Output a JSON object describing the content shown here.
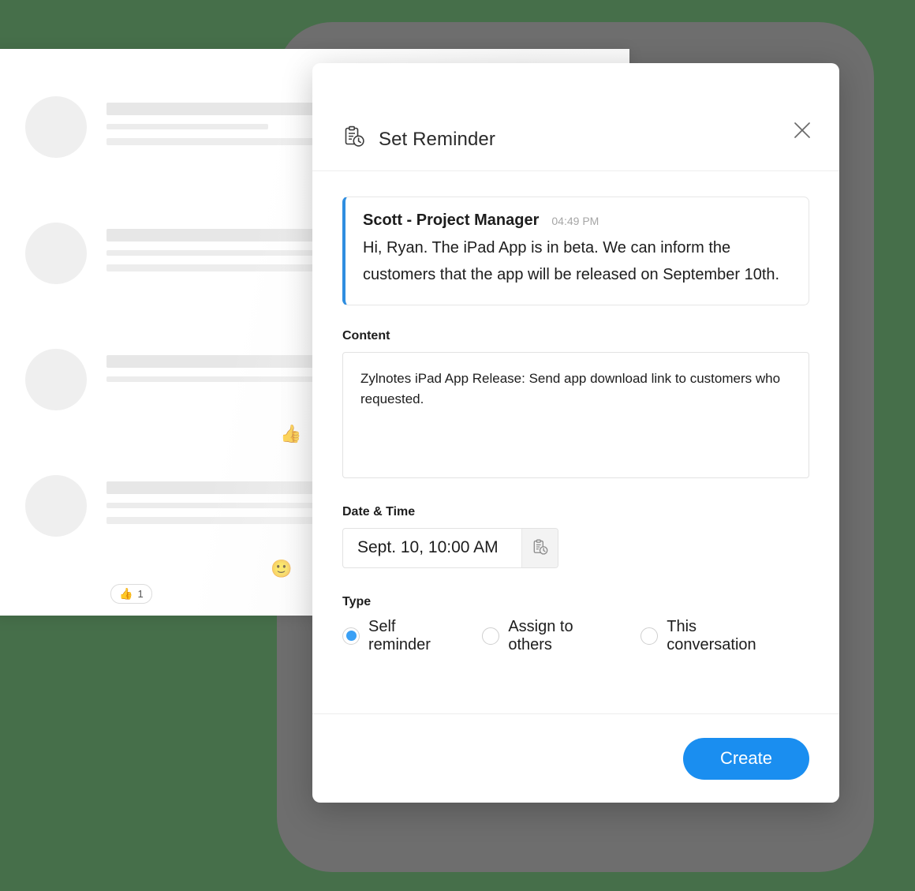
{
  "theme": {
    "page_background": "#466f4a",
    "device_frame": "#6e6e6e",
    "accent_blue": "#1a8ef0",
    "quote_border_blue": "#2f8ee0",
    "radio_blue": "#3aa0f5"
  },
  "background_chat": {
    "rows": [
      {
        "reaction": null,
        "emoji": null
      },
      {
        "reaction": null,
        "emoji": null
      },
      {
        "reaction": null,
        "emoji": "thumbs-up"
      },
      {
        "reaction": {
          "emoji": "thumbs-up",
          "count": "1"
        },
        "emoji": "smiley"
      }
    ]
  },
  "modal": {
    "icon": "clipboard-clock-icon",
    "title": "Set Reminder",
    "close_icon": "close-icon",
    "quote": {
      "author": "Scott - Project Manager",
      "time": "04:49 PM",
      "text": "Hi, Ryan. The iPad App is in beta. We can inform the customers that the app will be released on September 10th."
    },
    "content": {
      "label": "Content",
      "value": "Zylnotes iPad App Release: Send app download link to customers who requested.",
      "placeholder": "Content"
    },
    "datetime": {
      "label": "Date & Time",
      "value": "Sept. 10, 10:00 AM",
      "picker_icon": "clipboard-clock-icon"
    },
    "type": {
      "label": "Type",
      "options": [
        {
          "label": "Self reminder",
          "selected": true
        },
        {
          "label": "Assign to others",
          "selected": false
        },
        {
          "label": "This conversation",
          "selected": false
        }
      ]
    },
    "footer": {
      "create_label": "Create"
    }
  }
}
